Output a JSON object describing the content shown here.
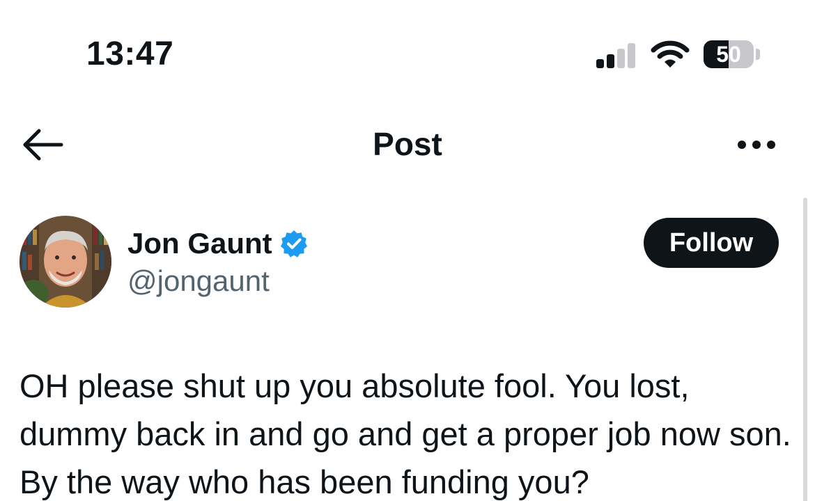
{
  "status_bar": {
    "time": "13:47",
    "battery_level": "50",
    "battery_fraction": 0.5,
    "icons": [
      "cellular-signal-icon",
      "wifi-icon",
      "battery-icon"
    ]
  },
  "nav": {
    "title": "Post",
    "back_icon": "back-arrow-icon",
    "more_icon": "more-options-icon"
  },
  "author": {
    "display_name": "Jon Gaunt",
    "handle": "@jongaunt",
    "verified": true,
    "verified_color": "#1d9bf0"
  },
  "follow_button": {
    "label": "Follow"
  },
  "post": {
    "text": "OH please shut up you absolute fool. You lost, dummy back in and go and get a proper job now son. By the way who has been funding you?"
  },
  "colors": {
    "text_primary": "#0f1419",
    "text_secondary": "#536471",
    "accent_blue": "#1d9bf0",
    "button_bg": "#0f1419"
  }
}
